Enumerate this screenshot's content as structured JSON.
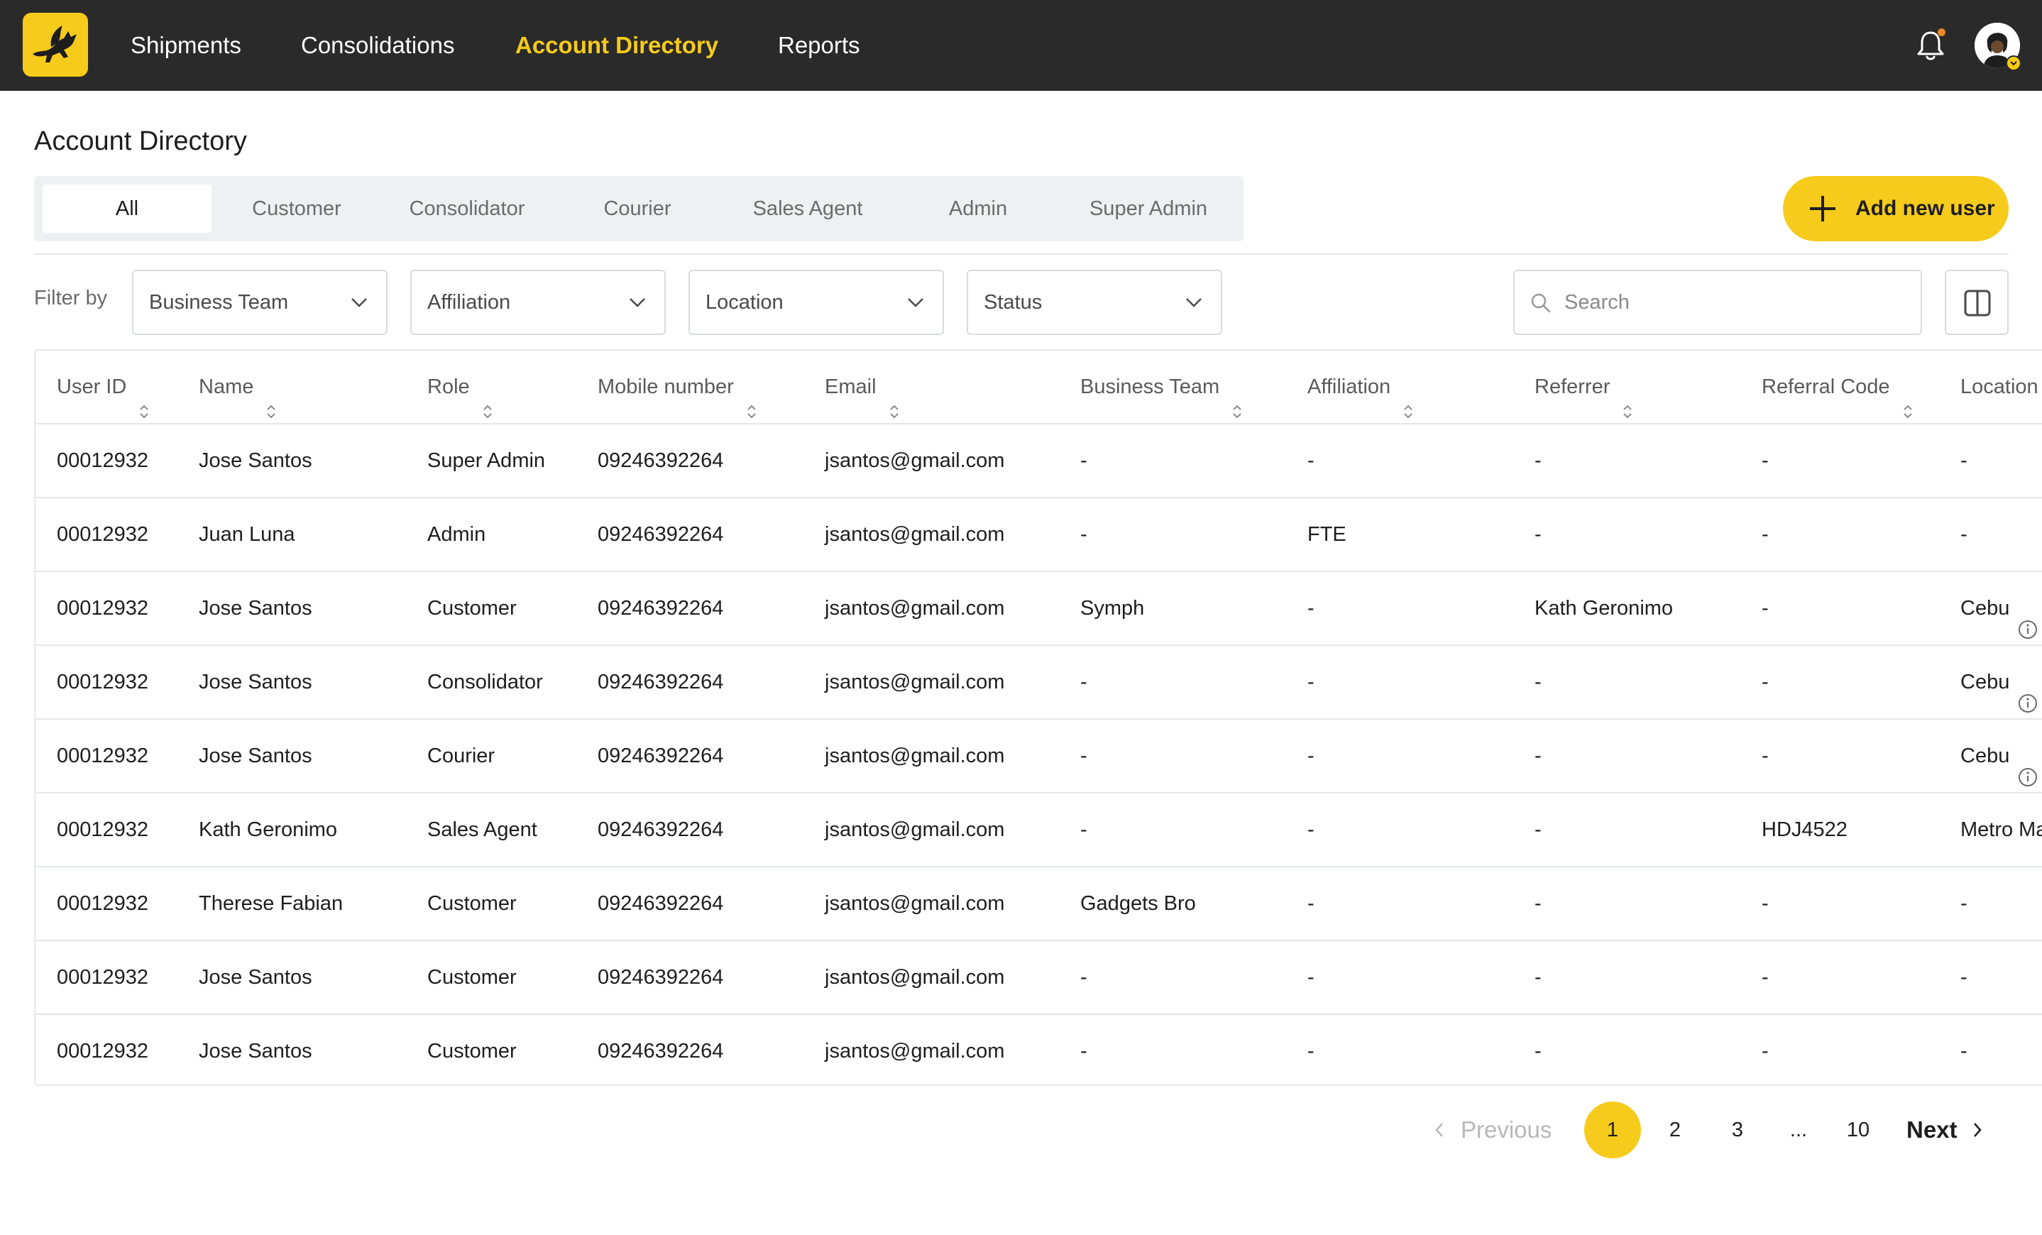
{
  "nav": {
    "items": [
      {
        "label": "Shipments",
        "active": false
      },
      {
        "label": "Consolidations",
        "active": false
      },
      {
        "label": "Account Directory",
        "active": true
      },
      {
        "label": "Reports",
        "active": false
      }
    ],
    "notifications_icon": "bell-icon",
    "has_unread_notifications": true,
    "avatar_icon": "user-avatar"
  },
  "page": {
    "title": "Account Directory"
  },
  "tabs": [
    {
      "label": "All",
      "active": true
    },
    {
      "label": "Customer",
      "active": false
    },
    {
      "label": "Consolidator",
      "active": false
    },
    {
      "label": "Courier",
      "active": false
    },
    {
      "label": "Sales Agent",
      "active": false
    },
    {
      "label": "Admin",
      "active": false
    },
    {
      "label": "Super Admin",
      "active": false
    }
  ],
  "actions": {
    "add_user_label": "Add new user"
  },
  "filters": {
    "label": "Filter by",
    "selects": [
      "Business Team",
      "Affiliation",
      "Location",
      "Status"
    ],
    "search_placeholder": "Search"
  },
  "table": {
    "columns": [
      "User ID",
      "Name",
      "Role",
      "Mobile number",
      "Email",
      "Business Team",
      "Affiliation",
      "Referrer",
      "Referral Code",
      "Location"
    ],
    "rows": [
      {
        "user_id": "00012932",
        "name": "Jose Santos",
        "role": "Super Admin",
        "mobile": "09246392264",
        "email": "jsantos@gmail.com",
        "business_team": "-",
        "affiliation": "-",
        "referrer": "-",
        "referral_code": "-",
        "location": "-",
        "location_info": false
      },
      {
        "user_id": "00012932",
        "name": "Juan Luna",
        "role": "Admin",
        "mobile": "09246392264",
        "email": "jsantos@gmail.com",
        "business_team": "-",
        "affiliation": "FTE",
        "referrer": "-",
        "referral_code": "-",
        "location": "-",
        "location_info": false
      },
      {
        "user_id": "00012932",
        "name": "Jose Santos",
        "role": "Customer",
        "mobile": "09246392264",
        "email": "jsantos@gmail.com",
        "business_team": "Symph",
        "affiliation": "-",
        "referrer": "Kath Geronimo",
        "referral_code": "-",
        "location": "Cebu",
        "location_info": true
      },
      {
        "user_id": "00012932",
        "name": "Jose Santos",
        "role": "Consolidator",
        "mobile": "09246392264",
        "email": "jsantos@gmail.com",
        "business_team": "-",
        "affiliation": "-",
        "referrer": "-",
        "referral_code": "-",
        "location": "Cebu",
        "location_info": true
      },
      {
        "user_id": "00012932",
        "name": "Jose Santos",
        "role": "Courier",
        "mobile": "09246392264",
        "email": "jsantos@gmail.com",
        "business_team": "-",
        "affiliation": "-",
        "referrer": "-",
        "referral_code": "-",
        "location": "Cebu",
        "location_info": true
      },
      {
        "user_id": "00012932",
        "name": "Kath Geronimo",
        "role": "Sales Agent",
        "mobile": "09246392264",
        "email": "jsantos@gmail.com",
        "business_team": "-",
        "affiliation": "-",
        "referrer": "-",
        "referral_code": "HDJ4522",
        "location": "Metro Ma",
        "location_info": false
      },
      {
        "user_id": "00012932",
        "name": "Therese Fabian",
        "role": "Customer",
        "mobile": "09246392264",
        "email": "jsantos@gmail.com",
        "business_team": "Gadgets Bro",
        "affiliation": "-",
        "referrer": "-",
        "referral_code": "-",
        "location": "-",
        "location_info": false
      },
      {
        "user_id": "00012932",
        "name": "Jose Santos",
        "role": "Customer",
        "mobile": "09246392264",
        "email": "jsantos@gmail.com",
        "business_team": "-",
        "affiliation": "-",
        "referrer": "-",
        "referral_code": "-",
        "location": "-",
        "location_info": false
      },
      {
        "user_id": "00012932",
        "name": "Jose Santos",
        "role": "Customer",
        "mobile": "09246392264",
        "email": "jsantos@gmail.com",
        "business_team": "-",
        "affiliation": "-",
        "referrer": "-",
        "referral_code": "-",
        "location": "-",
        "location_info": false
      }
    ]
  },
  "pagination": {
    "previous_label": "Previous",
    "next_label": "Next",
    "pages": [
      "1",
      "2",
      "3",
      "...",
      "10"
    ],
    "current": "1"
  },
  "colors": {
    "accent": "#f6cb1b",
    "topbar": "#2a2a2a",
    "border": "#e4e6e8",
    "notification_dot": "#e8892a"
  }
}
